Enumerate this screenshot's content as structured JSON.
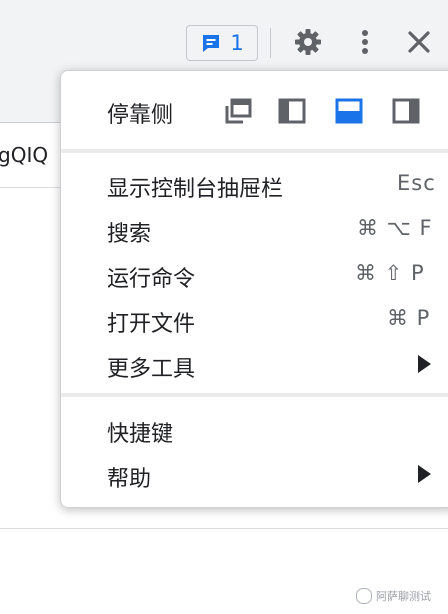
{
  "toolbar": {
    "issues_count": "1",
    "icons": [
      "issues-icon",
      "gear-icon",
      "kebab-menu-icon",
      "close-icon"
    ]
  },
  "content": {
    "text": "gQIQ"
  },
  "menu": {
    "dock_label": "停靠侧",
    "dock_options": [
      "undock-into-separate-window-icon",
      "dock-to-left-icon",
      "dock-to-bottom-icon",
      "dock-to-right-icon"
    ],
    "dock_selected": "dock-to-bottom-icon",
    "items": [
      {
        "label": "显示控制台抽屉栏",
        "shortcut": "Esc"
      },
      {
        "label": "搜索",
        "shortcut": "⌘ ⌥ F"
      },
      {
        "label": "运行命令",
        "shortcut": "⌘ ⇧ P"
      },
      {
        "label": "打开文件",
        "shortcut": "⌘ P"
      },
      {
        "label": "更多工具",
        "submenu": true
      }
    ],
    "items2": [
      {
        "label": "快捷键"
      },
      {
        "label": "帮助",
        "submenu": true
      }
    ]
  },
  "watermark": "阿萨聊测试",
  "colors": {
    "accent": "#1a73e8",
    "toolbar_bg": "#f1f3f4",
    "icon_gray": "#5f6368"
  }
}
